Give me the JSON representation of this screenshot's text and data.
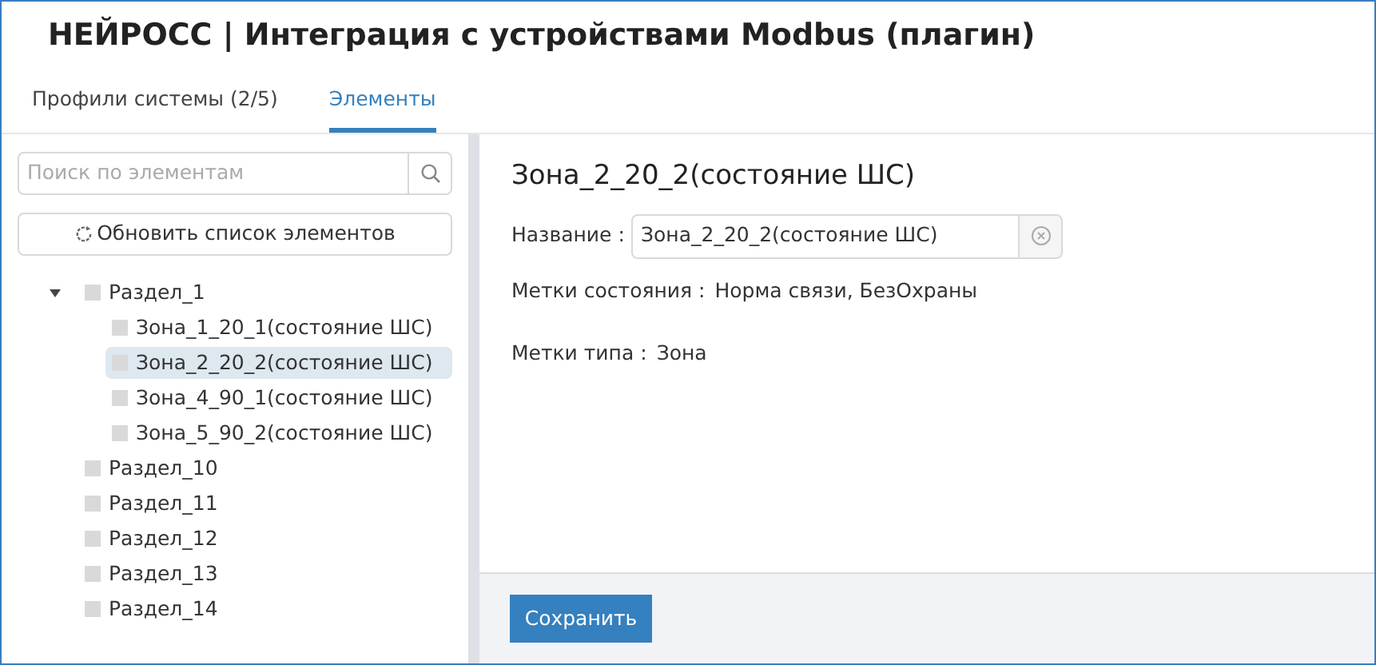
{
  "window": {
    "title": "НЕЙРОСС | Интеграция с устройствами Modbus (плагин)"
  },
  "tabs": [
    {
      "label": "Профили системы (2/5)",
      "selected": false
    },
    {
      "label": "Элементы",
      "selected": true
    }
  ],
  "search": {
    "placeholder": "Поиск по элементам"
  },
  "refresh_button": "Обновить список элементов",
  "tree": [
    {
      "label": "Раздел_1",
      "expanded": true,
      "selected": false,
      "children": [
        {
          "label": "Зона_1_20_1(состояние ШС)",
          "selected": false
        },
        {
          "label": "Зона_2_20_2(состояние ШС)",
          "selected": true
        },
        {
          "label": "Зона_4_90_1(состояние ШС)",
          "selected": false
        },
        {
          "label": "Зона_5_90_2(состояние ШС)",
          "selected": false
        }
      ]
    },
    {
      "label": "Раздел_10",
      "selected": false
    },
    {
      "label": "Раздел_11",
      "selected": false
    },
    {
      "label": "Раздел_12",
      "selected": false
    },
    {
      "label": "Раздел_13",
      "selected": false
    },
    {
      "label": "Раздел_14",
      "selected": false
    }
  ],
  "details": {
    "heading": "Зона_2_20_2(состояние ШС)",
    "name_label": "Название :",
    "name_value": "Зона_2_20_2(состояние ШС)",
    "fields": [
      {
        "label": "Метки состояния :",
        "value": "Норма связи, БезОхраны"
      },
      {
        "label": "Метки типа :",
        "value": "Зона"
      }
    ]
  },
  "save_button": "Сохранить"
}
